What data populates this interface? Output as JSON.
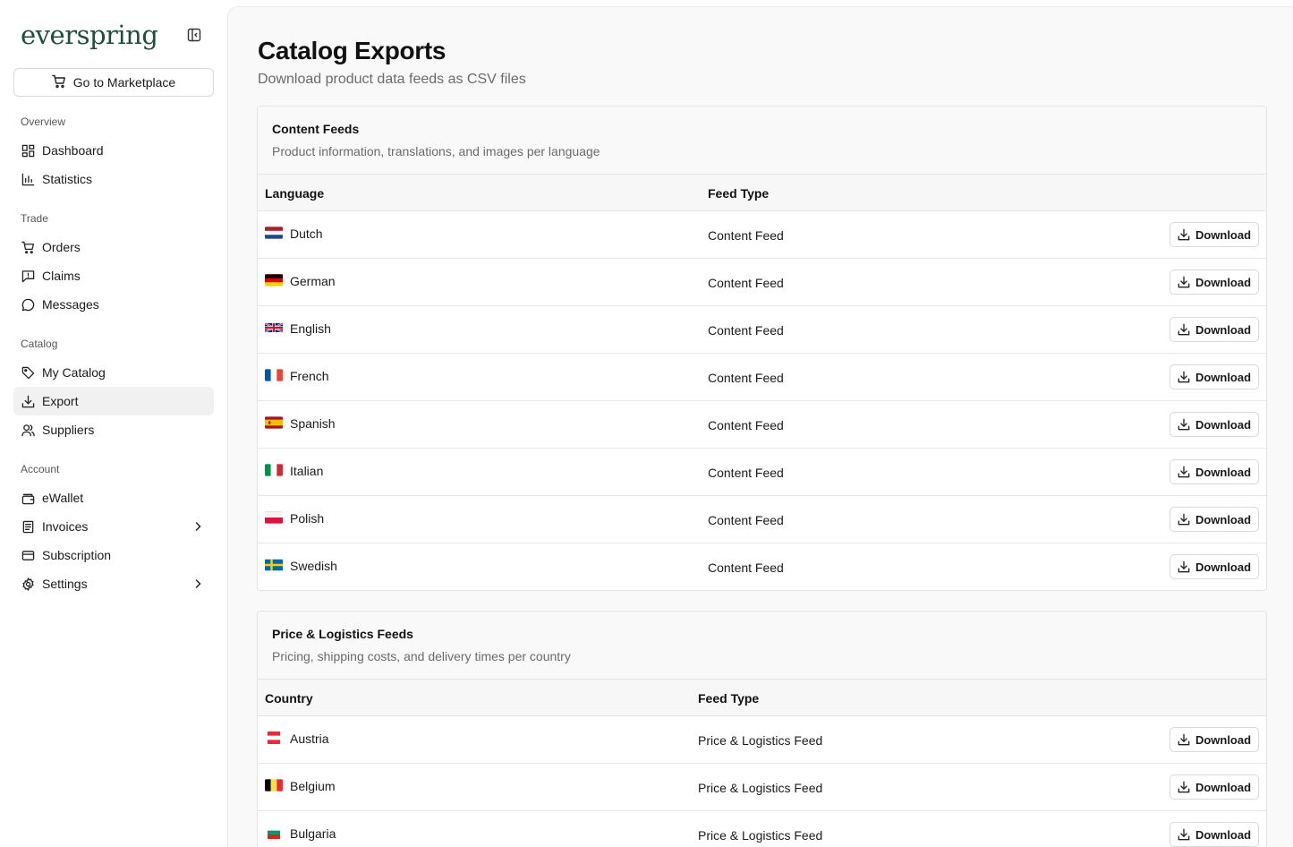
{
  "sidebar": {
    "logo": "everspring",
    "marketplace_button": "Go to Marketplace",
    "sections": [
      {
        "label": "Overview",
        "items": [
          {
            "label": "Dashboard",
            "icon": "dashboard-icon"
          },
          {
            "label": "Statistics",
            "icon": "bar-chart-icon"
          }
        ]
      },
      {
        "label": "Trade",
        "items": [
          {
            "label": "Orders",
            "icon": "cart-icon"
          },
          {
            "label": "Claims",
            "icon": "alert-message-icon"
          },
          {
            "label": "Messages",
            "icon": "message-circle-icon"
          }
        ]
      },
      {
        "label": "Catalog",
        "items": [
          {
            "label": "My Catalog",
            "icon": "tag-icon"
          },
          {
            "label": "Export",
            "icon": "download-icon",
            "active": true
          },
          {
            "label": "Suppliers",
            "icon": "users-icon"
          }
        ]
      },
      {
        "label": "Account",
        "items": [
          {
            "label": "eWallet",
            "icon": "wallet-icon"
          },
          {
            "label": "Invoices",
            "icon": "receipt-icon",
            "has_submenu": true
          },
          {
            "label": "Subscription",
            "icon": "credit-card-icon"
          },
          {
            "label": "Settings",
            "icon": "gear-icon",
            "has_submenu": true
          }
        ]
      }
    ]
  },
  "header": {
    "title": "Catalog Exports",
    "subtitle": "Download product data feeds as CSV files"
  },
  "content_feeds": {
    "title": "Content Feeds",
    "description": "Product information, translations, and images per language",
    "columns": [
      "Language",
      "Feed Type"
    ],
    "button_label": "Download",
    "rows": [
      {
        "name": "Dutch",
        "flag": "nl",
        "type": "Content Feed"
      },
      {
        "name": "German",
        "flag": "de",
        "type": "Content Feed"
      },
      {
        "name": "English",
        "flag": "gb",
        "type": "Content Feed"
      },
      {
        "name": "French",
        "flag": "fr",
        "type": "Content Feed"
      },
      {
        "name": "Spanish",
        "flag": "es",
        "type": "Content Feed"
      },
      {
        "name": "Italian",
        "flag": "it",
        "type": "Content Feed"
      },
      {
        "name": "Polish",
        "flag": "pl",
        "type": "Content Feed"
      },
      {
        "name": "Swedish",
        "flag": "se",
        "type": "Content Feed"
      }
    ]
  },
  "price_feeds": {
    "title": "Price & Logistics Feeds",
    "description": "Pricing, shipping costs, and delivery times per country",
    "columns": [
      "Country",
      "Feed Type"
    ],
    "button_label": "Download",
    "rows": [
      {
        "name": "Austria",
        "flag": "at",
        "type": "Price & Logistics Feed"
      },
      {
        "name": "Belgium",
        "flag": "be",
        "type": "Price & Logistics Feed"
      },
      {
        "name": "Bulgaria",
        "flag": "bg",
        "type": "Price & Logistics Feed"
      }
    ]
  },
  "colors": {
    "brand": "#1f4d3f",
    "active_nav_bg": "#f1f1f1",
    "main_bg": "#f9f9f9"
  }
}
